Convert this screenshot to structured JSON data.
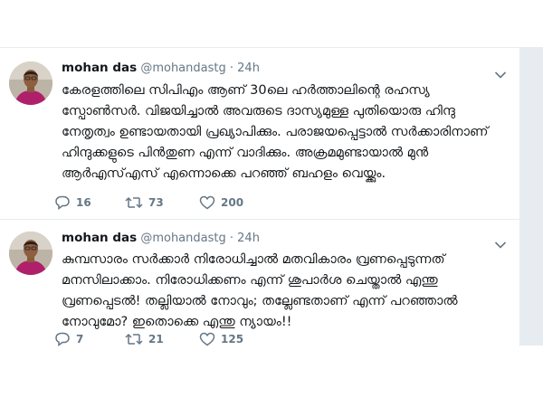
{
  "tweets": [
    {
      "name": "mohan das",
      "handle": "@mohandastg",
      "separator": "·",
      "time": "24h",
      "text": "കേരളത്തിലെ സിപിഎം ആണ് 30ലെ ഹർത്താലിന്റെ രഹസ്യ സ്പോൺസർ. വിജയിച്ചാൽ അവരുടെ ദാസ്യമുള്ള പുതിയൊരു ഹിന്ദു നേതൃത്വം ഉണ്ടായതായി പ്രഖ്യാപിക്കും. പരാജയപ്പെട്ടാൽ സർക്കാരിനാണ് ഹിന്ദുക്കളുടെ പിൻതുണ എന്ന് വാദിക്കും. അക്രമമുണ്ടായാൽ മുൻ ആർഎസ്എസ് എന്നൊക്കെ പറഞ്ഞ് ബഹളം വെയ്ക്കും.",
      "replies": "16",
      "retweets": "73",
      "likes": "200"
    },
    {
      "name": "mohan das",
      "handle": "@mohandastg",
      "separator": "·",
      "time": "24h",
      "text": "കുമ്പസാരം സർക്കാർ നിരോധിച്ചാൽ മതവികാരം വ്രണപ്പെടുന്നത് മനസിലാക്കാം. നിരോധിക്കണം എന്ന് ശുപാർശ ചെയ്താൽ എന്തു വ്രണപ്പെടൽ! തല്ലിയാൽ നോവും; തല്ലേണ്ടതാണ് എന്ന് പറഞ്ഞാൽ നോവുമോ? ഇതൊക്കെ എന്തു ന്യായം!!",
      "replies": "7",
      "retweets": "21",
      "likes": "125"
    }
  ],
  "icons": {
    "caret": "chevron-down-icon",
    "reply": "reply-icon",
    "retweet": "retweet-icon",
    "like": "heart-icon"
  },
  "colors": {
    "text": "#14171a",
    "secondary": "#657786",
    "divider": "#e6ecf0"
  }
}
